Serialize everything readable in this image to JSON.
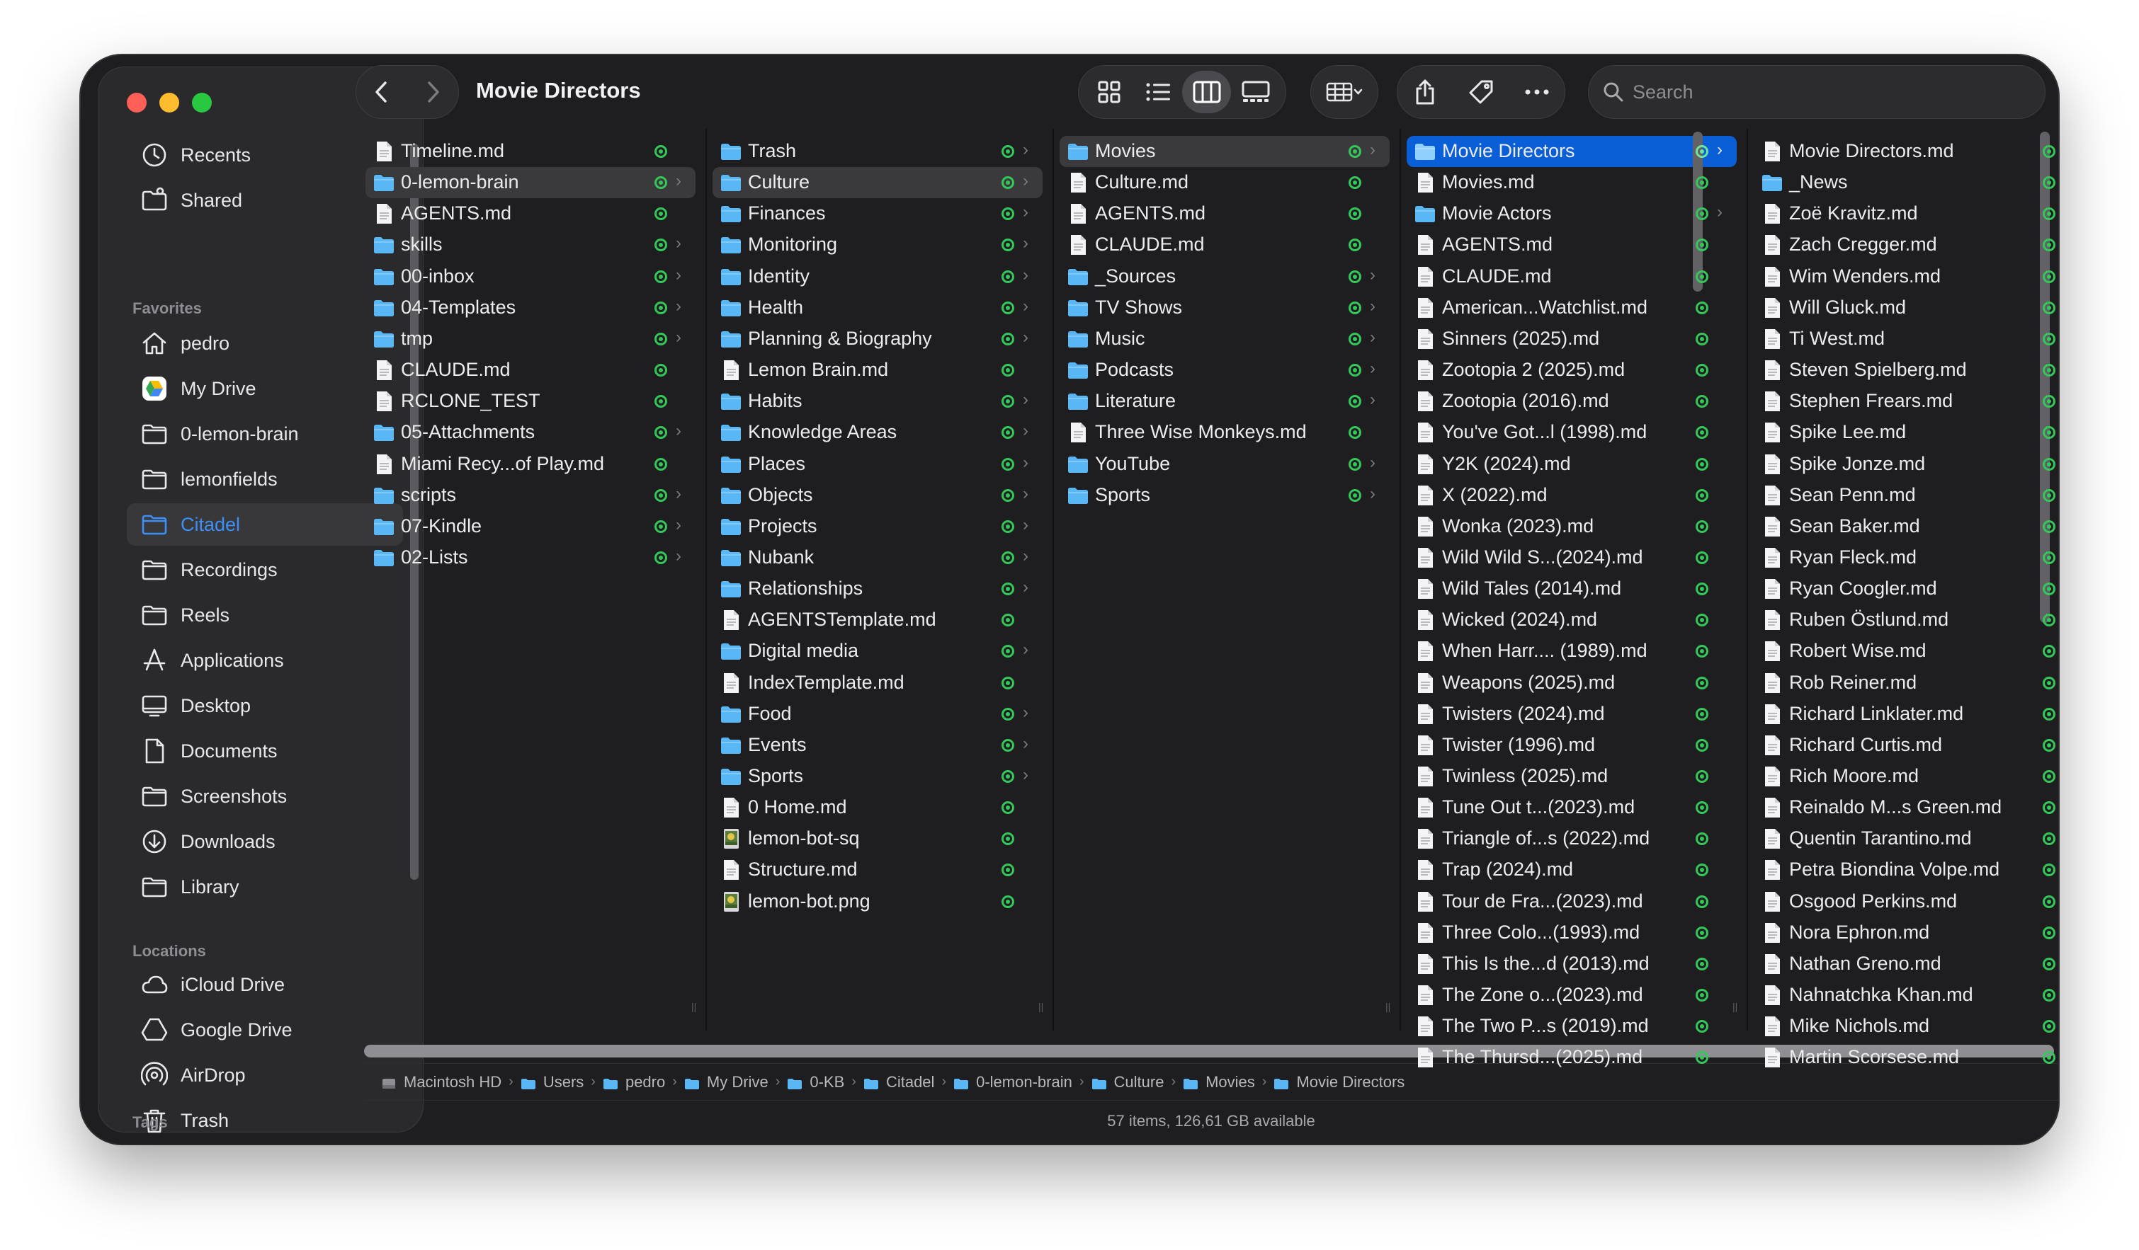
{
  "window": {
    "title": "Movie Directors"
  },
  "colors": {
    "accent": "#0b5fd6",
    "folder": "#5ab7f5",
    "synced": "#34c759"
  },
  "search": {
    "placeholder": "Search"
  },
  "sidebar": {
    "top_items": [
      {
        "label": "Recents",
        "icon": "clock-icon"
      },
      {
        "label": "Shared",
        "icon": "shared-folder-icon"
      }
    ],
    "favorites_label": "Favorites",
    "favorites": [
      {
        "label": "pedro",
        "icon": "home-icon"
      },
      {
        "label": "My Drive",
        "icon": "google-drive-icon"
      },
      {
        "label": "0-lemon-brain",
        "icon": "folder-icon"
      },
      {
        "label": "lemonfields",
        "icon": "folder-icon"
      },
      {
        "label": "Citadel",
        "icon": "folder-icon",
        "active": true
      },
      {
        "label": "Recordings",
        "icon": "folder-icon"
      },
      {
        "label": "Reels",
        "icon": "folder-icon"
      },
      {
        "label": "Applications",
        "icon": "applications-icon"
      },
      {
        "label": "Desktop",
        "icon": "desktop-icon"
      },
      {
        "label": "Documents",
        "icon": "document-icon"
      },
      {
        "label": "Screenshots",
        "icon": "folder-icon"
      },
      {
        "label": "Downloads",
        "icon": "download-icon"
      },
      {
        "label": "Library",
        "icon": "folder-icon"
      }
    ],
    "locations_label": "Locations",
    "locations": [
      {
        "label": "iCloud Drive",
        "icon": "cloud-icon"
      },
      {
        "label": "Google Drive",
        "icon": "google-drive-icon"
      },
      {
        "label": "AirDrop",
        "icon": "airdrop-icon"
      },
      {
        "label": "Trash",
        "icon": "trash-icon"
      }
    ],
    "tags_label": "Tags"
  },
  "columns": [
    {
      "items": [
        {
          "name": "Timeline.md",
          "type": "file"
        },
        {
          "name": "0-lemon-brain",
          "type": "folder",
          "state": "hl"
        },
        {
          "name": "AGENTS.md",
          "type": "file"
        },
        {
          "name": "skills",
          "type": "folder"
        },
        {
          "name": "00-inbox",
          "type": "folder"
        },
        {
          "name": "04-Templates",
          "type": "folder"
        },
        {
          "name": "tmp",
          "type": "folder"
        },
        {
          "name": "CLAUDE.md",
          "type": "file"
        },
        {
          "name": "RCLONE_TEST",
          "type": "file"
        },
        {
          "name": "05-Attachments",
          "type": "folder"
        },
        {
          "name": "Miami Recy...of Play.md",
          "type": "file"
        },
        {
          "name": "scripts",
          "type": "folder"
        },
        {
          "name": "07-Kindle",
          "type": "folder"
        },
        {
          "name": "02-Lists",
          "type": "folder"
        }
      ]
    },
    {
      "items": [
        {
          "name": "Trash",
          "type": "folder"
        },
        {
          "name": "Culture",
          "type": "folder",
          "state": "hl"
        },
        {
          "name": "Finances",
          "type": "folder"
        },
        {
          "name": "Monitoring",
          "type": "folder"
        },
        {
          "name": "Identity",
          "type": "folder"
        },
        {
          "name": "Health",
          "type": "folder"
        },
        {
          "name": "Planning & Biography",
          "type": "folder"
        },
        {
          "name": "Lemon Brain.md",
          "type": "file"
        },
        {
          "name": "Habits",
          "type": "folder"
        },
        {
          "name": "Knowledge Areas",
          "type": "folder"
        },
        {
          "name": "Places",
          "type": "folder"
        },
        {
          "name": "Objects",
          "type": "folder"
        },
        {
          "name": "Projects",
          "type": "folder"
        },
        {
          "name": "Nubank",
          "type": "folder"
        },
        {
          "name": "Relationships",
          "type": "folder"
        },
        {
          "name": "AGENTSTemplate.md",
          "type": "file"
        },
        {
          "name": "Digital media",
          "type": "folder"
        },
        {
          "name": "IndexTemplate.md",
          "type": "file"
        },
        {
          "name": "Food",
          "type": "folder"
        },
        {
          "name": "Events",
          "type": "folder"
        },
        {
          "name": "Sports",
          "type": "folder"
        },
        {
          "name": "0 Home.md",
          "type": "file"
        },
        {
          "name": "lemon-bot-sq",
          "type": "image"
        },
        {
          "name": "Structure.md",
          "type": "file"
        },
        {
          "name": "lemon-bot.png",
          "type": "image"
        }
      ]
    },
    {
      "items": [
        {
          "name": "Movies",
          "type": "folder",
          "state": "hl"
        },
        {
          "name": "Culture.md",
          "type": "file"
        },
        {
          "name": "AGENTS.md",
          "type": "file"
        },
        {
          "name": "CLAUDE.md",
          "type": "file"
        },
        {
          "name": "_Sources",
          "type": "folder"
        },
        {
          "name": "TV Shows",
          "type": "folder"
        },
        {
          "name": "Music",
          "type": "folder"
        },
        {
          "name": "Podcasts",
          "type": "folder"
        },
        {
          "name": "Literature",
          "type": "folder"
        },
        {
          "name": "Three Wise Monkeys.md",
          "type": "file"
        },
        {
          "name": "YouTube",
          "type": "folder"
        },
        {
          "name": "Sports",
          "type": "folder"
        }
      ]
    },
    {
      "items": [
        {
          "name": "Movie Directors",
          "type": "folder",
          "state": "sel"
        },
        {
          "name": "Movies.md",
          "type": "file"
        },
        {
          "name": "Movie Actors",
          "type": "folder"
        },
        {
          "name": "AGENTS.md",
          "type": "file"
        },
        {
          "name": "CLAUDE.md",
          "type": "file"
        },
        {
          "name": "American...Watchlist.md",
          "type": "file"
        },
        {
          "name": "Sinners (2025).md",
          "type": "file"
        },
        {
          "name": "Zootopia 2 (2025).md",
          "type": "file"
        },
        {
          "name": "Zootopia (2016).md",
          "type": "file"
        },
        {
          "name": "You've Got...l (1998).md",
          "type": "file"
        },
        {
          "name": "Y2K (2024).md",
          "type": "file"
        },
        {
          "name": "X (2022).md",
          "type": "file"
        },
        {
          "name": "Wonka (2023).md",
          "type": "file"
        },
        {
          "name": "Wild Wild S...(2024).md",
          "type": "file"
        },
        {
          "name": "Wild Tales (2014).md",
          "type": "file"
        },
        {
          "name": "Wicked (2024).md",
          "type": "file"
        },
        {
          "name": "When Harr.... (1989).md",
          "type": "file"
        },
        {
          "name": "Weapons (2025).md",
          "type": "file"
        },
        {
          "name": "Twisters (2024).md",
          "type": "file"
        },
        {
          "name": "Twister (1996).md",
          "type": "file"
        },
        {
          "name": "Twinless (2025).md",
          "type": "file"
        },
        {
          "name": "Tune Out t...(2023).md",
          "type": "file"
        },
        {
          "name": "Triangle of...s (2022).md",
          "type": "file"
        },
        {
          "name": "Trap (2024).md",
          "type": "file"
        },
        {
          "name": "Tour de Fra...(2023).md",
          "type": "file"
        },
        {
          "name": "Three Colo...(1993).md",
          "type": "file"
        },
        {
          "name": "This Is the...d (2013).md",
          "type": "file"
        },
        {
          "name": "The Zone o...(2023).md",
          "type": "file"
        },
        {
          "name": "The Two P...s (2019).md",
          "type": "file"
        },
        {
          "name": "The Thursd...(2025).md",
          "type": "file"
        }
      ]
    },
    {
      "items": [
        {
          "name": "Movie Directors.md",
          "type": "file"
        },
        {
          "name": "_News",
          "type": "folder"
        },
        {
          "name": "Zoë Kravitz.md",
          "type": "file"
        },
        {
          "name": "Zach Cregger.md",
          "type": "file"
        },
        {
          "name": "Wim Wenders.md",
          "type": "file"
        },
        {
          "name": "Will Gluck.md",
          "type": "file"
        },
        {
          "name": "Ti West.md",
          "type": "file"
        },
        {
          "name": "Steven Spielberg.md",
          "type": "file"
        },
        {
          "name": "Stephen Frears.md",
          "type": "file"
        },
        {
          "name": "Spike Lee.md",
          "type": "file"
        },
        {
          "name": "Spike Jonze.md",
          "type": "file"
        },
        {
          "name": "Sean Penn.md",
          "type": "file"
        },
        {
          "name": "Sean Baker.md",
          "type": "file"
        },
        {
          "name": "Ryan Fleck.md",
          "type": "file"
        },
        {
          "name": "Ryan Coogler.md",
          "type": "file"
        },
        {
          "name": "Ruben Östlund.md",
          "type": "file"
        },
        {
          "name": "Robert Wise.md",
          "type": "file"
        },
        {
          "name": "Rob Reiner.md",
          "type": "file"
        },
        {
          "name": "Richard Linklater.md",
          "type": "file"
        },
        {
          "name": "Richard Curtis.md",
          "type": "file"
        },
        {
          "name": "Rich Moore.md",
          "type": "file"
        },
        {
          "name": "Reinaldo M...s Green.md",
          "type": "file"
        },
        {
          "name": "Quentin Tarantino.md",
          "type": "file"
        },
        {
          "name": "Petra Biondina Volpe.md",
          "type": "file"
        },
        {
          "name": "Osgood Perkins.md",
          "type": "file"
        },
        {
          "name": "Nora Ephron.md",
          "type": "file"
        },
        {
          "name": "Nathan Greno.md",
          "type": "file"
        },
        {
          "name": "Nahnatchka Khan.md",
          "type": "file"
        },
        {
          "name": "Mike Nichols.md",
          "type": "file"
        },
        {
          "name": "Martin Scorsese.md",
          "type": "file"
        }
      ]
    }
  ],
  "path": [
    "Macintosh HD",
    "Users",
    "pedro",
    "My Drive",
    "0-KB",
    "Citadel",
    "0-lemon-brain",
    "Culture",
    "Movies",
    "Movie Directors"
  ],
  "status": {
    "text": "57 items, 126,61 GB available"
  }
}
